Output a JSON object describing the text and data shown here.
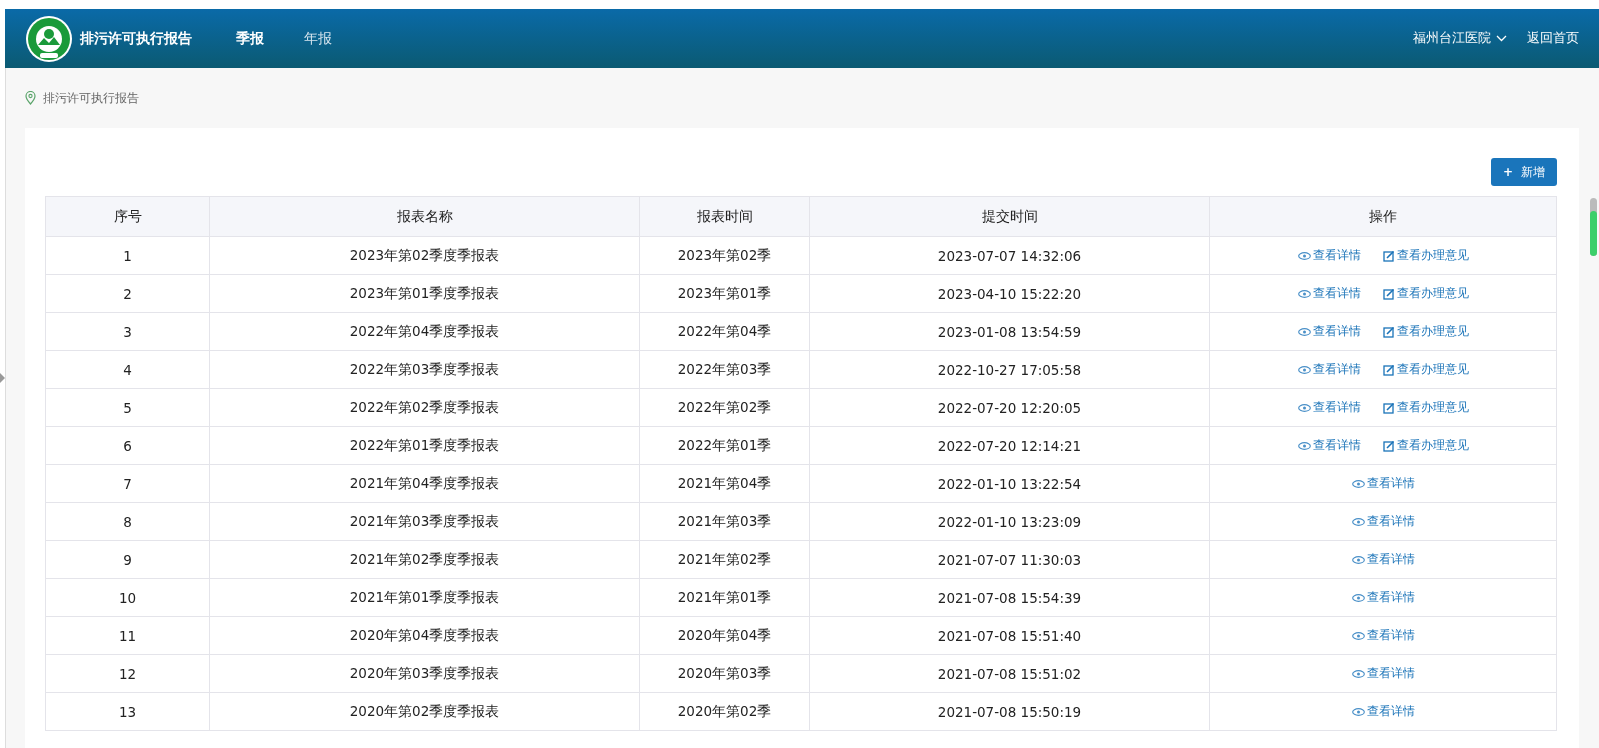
{
  "header": {
    "title": "排污许可执行报告",
    "nav": [
      {
        "label": "季报",
        "selected": true
      },
      {
        "label": "年报",
        "selected": false
      }
    ],
    "org": "福州台江医院",
    "home": "返回首页"
  },
  "breadcrumb": "排污许可执行报告",
  "add_button": {
    "icon": "+",
    "label": "新增"
  },
  "table": {
    "columns": [
      "序号",
      "报表名称",
      "报表时间",
      "提交时间",
      "操作"
    ],
    "rows": [
      {
        "no": "1",
        "name": "2023年第02季度季报表",
        "period": "2023年第02季",
        "submitted": "2023-07-07 14:32:06",
        "actions": [
          {
            "kind": "view",
            "label": "查看详情"
          },
          {
            "kind": "opinion",
            "label": "查看办理意见"
          }
        ]
      },
      {
        "no": "2",
        "name": "2023年第01季度季报表",
        "period": "2023年第01季",
        "submitted": "2023-04-10 15:22:20",
        "actions": [
          {
            "kind": "view",
            "label": "查看详情"
          },
          {
            "kind": "opinion",
            "label": "查看办理意见"
          }
        ]
      },
      {
        "no": "3",
        "name": "2022年第04季度季报表",
        "period": "2022年第04季",
        "submitted": "2023-01-08 13:54:59",
        "actions": [
          {
            "kind": "view",
            "label": "查看详情"
          },
          {
            "kind": "opinion",
            "label": "查看办理意见"
          }
        ]
      },
      {
        "no": "4",
        "name": "2022年第03季度季报表",
        "period": "2022年第03季",
        "submitted": "2022-10-27 17:05:58",
        "actions": [
          {
            "kind": "view",
            "label": "查看详情"
          },
          {
            "kind": "opinion",
            "label": "查看办理意见"
          }
        ]
      },
      {
        "no": "5",
        "name": "2022年第02季度季报表",
        "period": "2022年第02季",
        "submitted": "2022-07-20 12:20:05",
        "actions": [
          {
            "kind": "view",
            "label": "查看详情"
          },
          {
            "kind": "opinion",
            "label": "查看办理意见"
          }
        ]
      },
      {
        "no": "6",
        "name": "2022年第01季度季报表",
        "period": "2022年第01季",
        "submitted": "2022-07-20 12:14:21",
        "actions": [
          {
            "kind": "view",
            "label": "查看详情"
          },
          {
            "kind": "opinion",
            "label": "查看办理意见"
          }
        ]
      },
      {
        "no": "7",
        "name": "2021年第04季度季报表",
        "period": "2021年第04季",
        "submitted": "2022-01-10 13:22:54",
        "actions": [
          {
            "kind": "view",
            "label": "查看详情"
          }
        ]
      },
      {
        "no": "8",
        "name": "2021年第03季度季报表",
        "period": "2021年第03季",
        "submitted": "2022-01-10 13:23:09",
        "actions": [
          {
            "kind": "view",
            "label": "查看详情"
          }
        ]
      },
      {
        "no": "9",
        "name": "2021年第02季度季报表",
        "period": "2021年第02季",
        "submitted": "2021-07-07 11:30:03",
        "actions": [
          {
            "kind": "view",
            "label": "查看详情"
          }
        ]
      },
      {
        "no": "10",
        "name": "2021年第01季度季报表",
        "period": "2021年第01季",
        "submitted": "2021-07-08 15:54:39",
        "actions": [
          {
            "kind": "view",
            "label": "查看详情"
          }
        ]
      },
      {
        "no": "11",
        "name": "2020年第04季度季报表",
        "period": "2020年第04季",
        "submitted": "2021-07-08 15:51:40",
        "actions": [
          {
            "kind": "view",
            "label": "查看详情"
          }
        ]
      },
      {
        "no": "12",
        "name": "2020年第03季度季报表",
        "period": "2020年第03季",
        "submitted": "2021-07-08 15:51:02",
        "actions": [
          {
            "kind": "view",
            "label": "查看详情"
          }
        ]
      },
      {
        "no": "13",
        "name": "2020年第02季度季报表",
        "period": "2020年第02季",
        "submitted": "2021-07-08 15:50:19",
        "actions": [
          {
            "kind": "view",
            "label": "查看详情"
          }
        ]
      }
    ]
  }
}
